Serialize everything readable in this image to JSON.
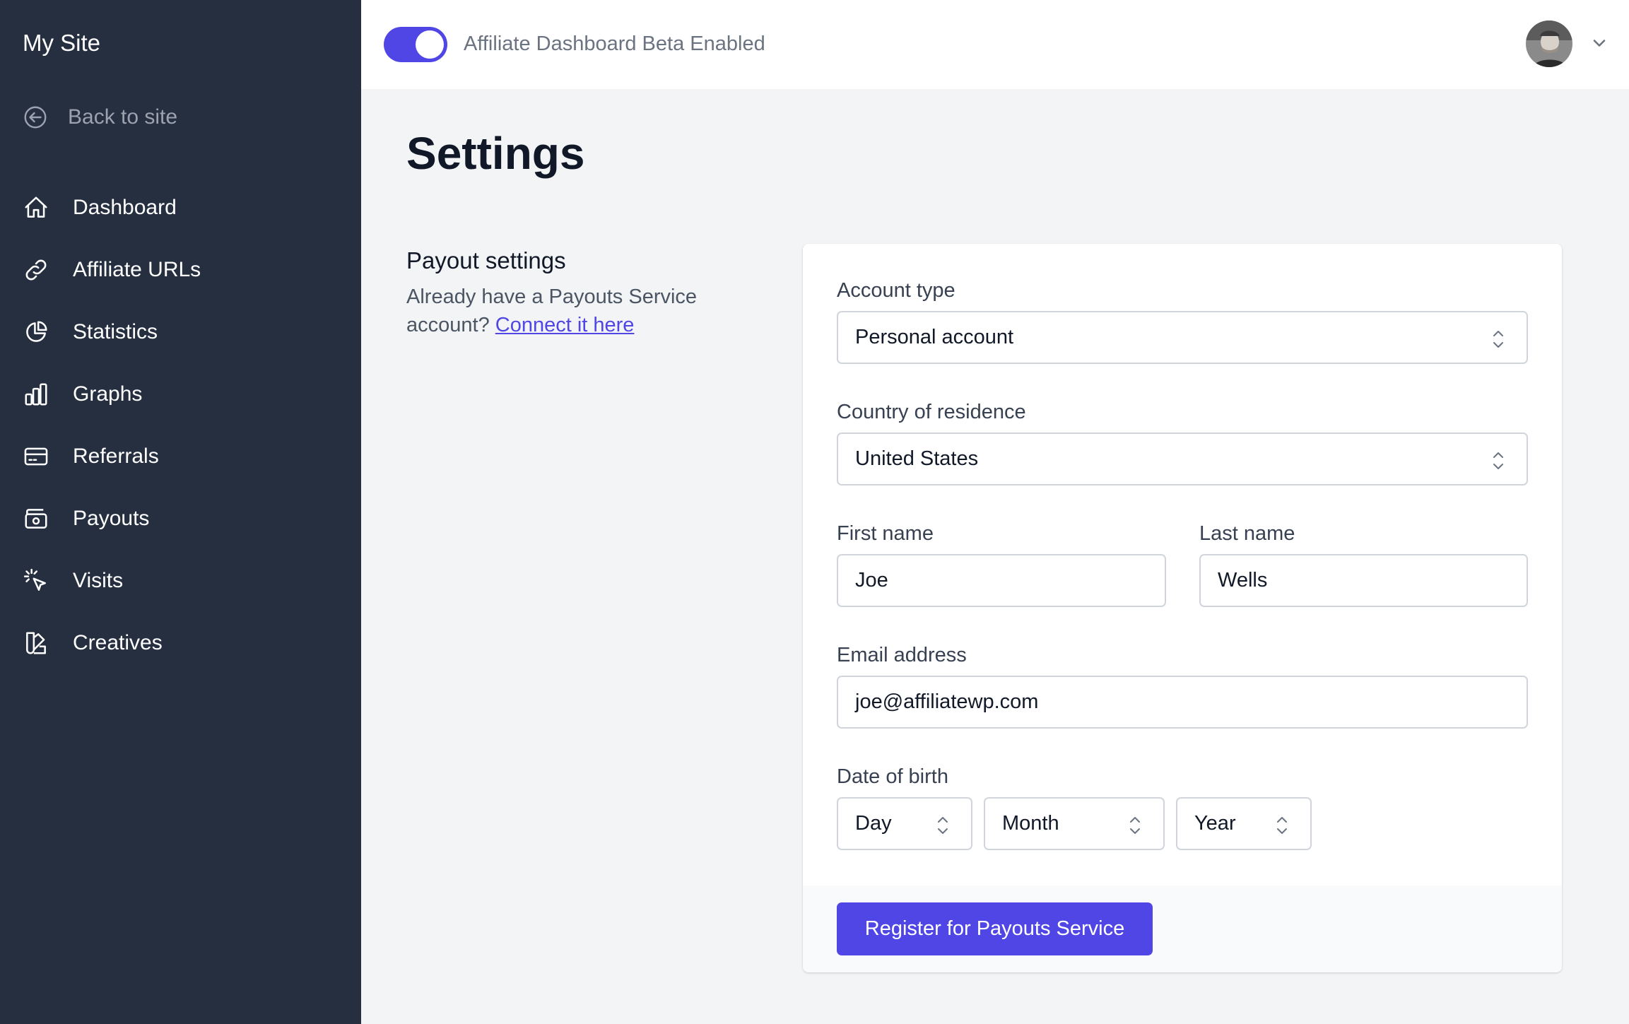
{
  "sidebar": {
    "site_name": "My Site",
    "back_label": "Back to site",
    "items": [
      {
        "label": "Dashboard",
        "icon": "home-icon"
      },
      {
        "label": "Affiliate URLs",
        "icon": "link-icon"
      },
      {
        "label": "Statistics",
        "icon": "pie-chart-icon"
      },
      {
        "label": "Graphs",
        "icon": "bar-chart-icon"
      },
      {
        "label": "Referrals",
        "icon": "credit-card-icon"
      },
      {
        "label": "Payouts",
        "icon": "cash-icon"
      },
      {
        "label": "Visits",
        "icon": "cursor-click-icon"
      },
      {
        "label": "Creatives",
        "icon": "color-swatch-icon"
      }
    ]
  },
  "topbar": {
    "toggle_label": "Affiliate Dashboard Beta Enabled",
    "toggle_on": true
  },
  "page": {
    "title": "Settings"
  },
  "payout_section": {
    "title": "Payout settings",
    "desc_prefix": "Already have a Payouts Service account?",
    "connect_link": "Connect it here"
  },
  "form": {
    "account_type_label": "Account type",
    "account_type_value": "Personal account",
    "country_label": "Country of residence",
    "country_value": "United States",
    "first_name_label": "First name",
    "first_name_value": "Joe",
    "last_name_label": "Last name",
    "last_name_value": "Wells",
    "email_label": "Email address",
    "email_value": "joe@affiliatewp.com",
    "dob_label": "Date of birth",
    "dob_day": "Day",
    "dob_month": "Month",
    "dob_year": "Year",
    "submit_label": "Register for Payouts Service"
  },
  "colors": {
    "sidebar_bg": "#252f40",
    "accent": "#5046e5",
    "page_bg": "#f3f4f6"
  }
}
